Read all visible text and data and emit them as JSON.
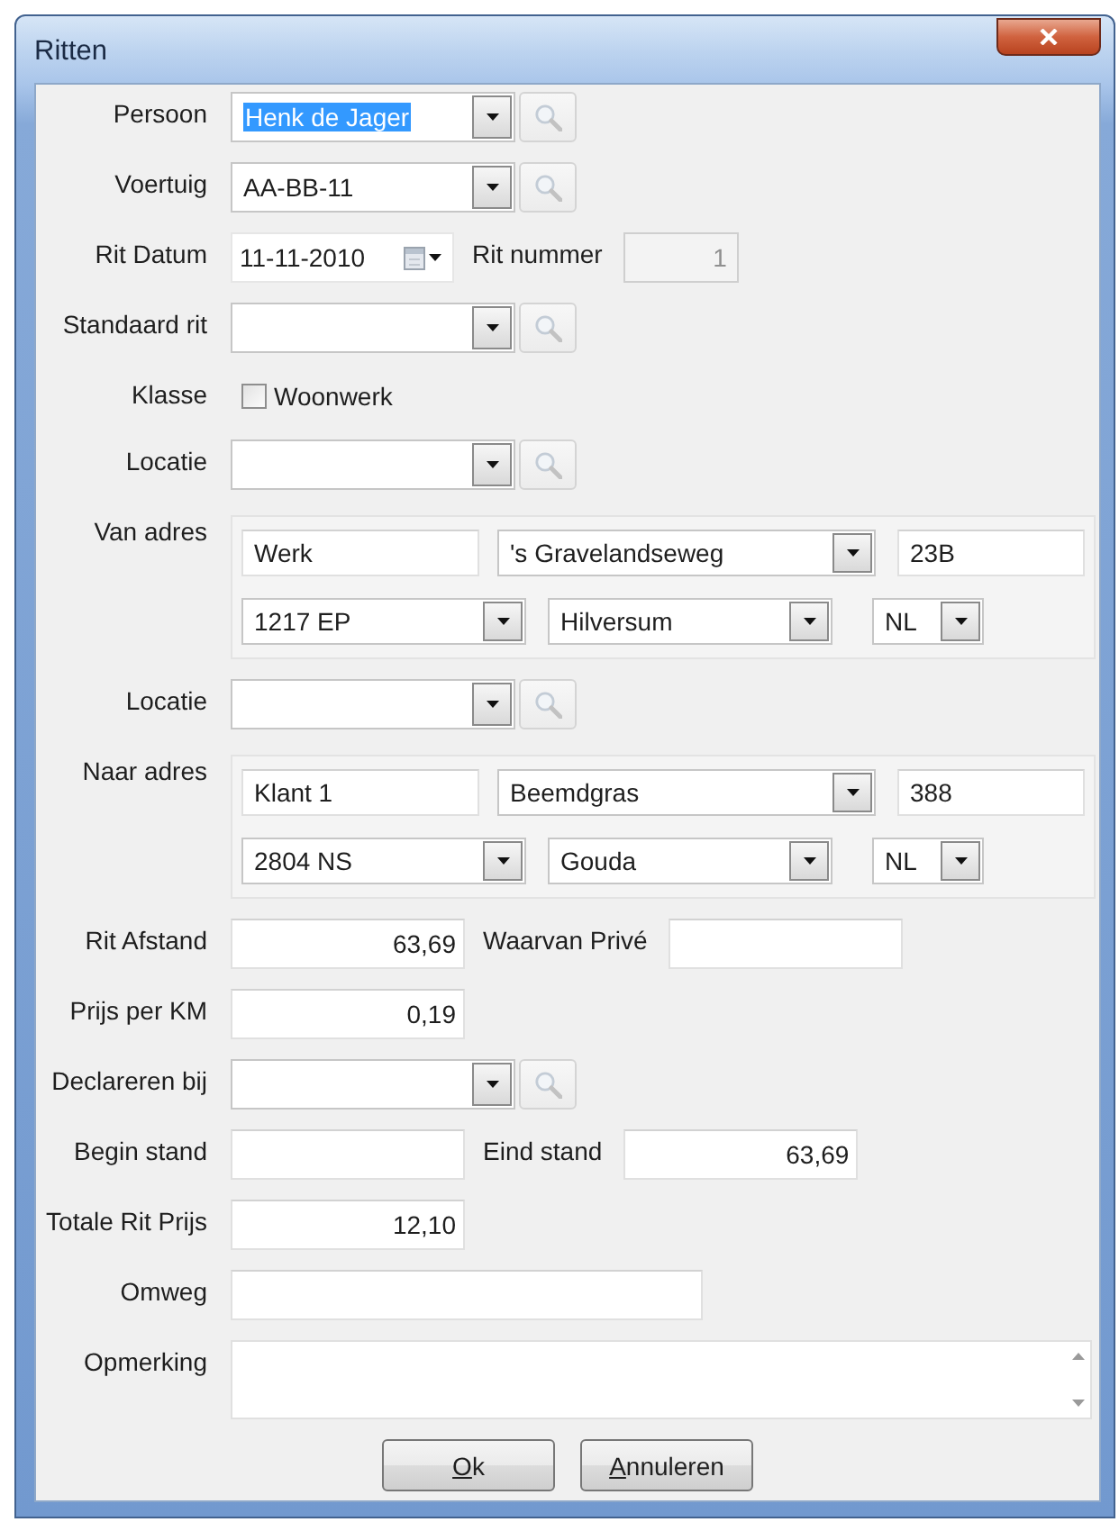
{
  "window": {
    "title": "Ritten"
  },
  "form": {
    "rows": [
      {
        "label": "Persoon",
        "controls": [
          {
            "kind": "lookup",
            "value": "Henk de Jager",
            "value_selected": true
          }
        ]
      },
      {
        "label": "Voertuig",
        "controls": [
          {
            "kind": "lookup",
            "value": "AA-BB-11",
            "value_selected": false
          }
        ]
      },
      {
        "label": "Rit Datum",
        "controls": [
          {
            "kind": "date",
            "value": "11-11-2010"
          },
          {
            "kind": "caption",
            "text": "Rit nummer"
          },
          {
            "kind": "counter",
            "value": "1",
            "disabled": true
          }
        ]
      },
      {
        "label": "Standaard rit",
        "controls": [
          {
            "kind": "lookup"
          }
        ]
      },
      {
        "label": "Klasse",
        "controls": [
          {
            "kind": "checkbox",
            "text": "Woonwerk",
            "checked": false
          }
        ]
      },
      {
        "label": "Locatie",
        "controls": [
          {
            "kind": "lookup"
          }
        ]
      },
      {
        "label": "Van adres",
        "controls": [
          {
            "kind": "address",
            "name": "Werk",
            "street": "'s Gravelandseweg",
            "number": "23B",
            "postcode": "1217 EP",
            "city": "Hilversum",
            "country": "NL"
          }
        ]
      },
      {
        "label": "Locatie",
        "controls": [
          {
            "kind": "lookup"
          }
        ]
      },
      {
        "label": "Naar adres",
        "controls": [
          {
            "kind": "address",
            "name": "Klant 1",
            "street": "Beemdgras",
            "number": "388",
            "postcode": "2804 NS",
            "city": "Gouda",
            "country": "NL"
          }
        ]
      },
      {
        "label": "Rit Afstand",
        "controls": [
          {
            "kind": "number",
            "value": "63,69"
          },
          {
            "kind": "caption",
            "text": "Waarvan Privé"
          },
          {
            "kind": "number"
          }
        ]
      },
      {
        "label": "Prijs per KM",
        "controls": [
          {
            "kind": "number",
            "value": "0,19"
          }
        ]
      },
      {
        "label": "Declareren bij",
        "controls": [
          {
            "kind": "lookup"
          }
        ]
      },
      {
        "label": "Begin stand",
        "controls": [
          {
            "kind": "number"
          },
          {
            "kind": "caption",
            "text": "Eind stand"
          },
          {
            "kind": "number",
            "value": "63,69"
          }
        ]
      },
      {
        "label": "Totale Rit Prijs",
        "controls": [
          {
            "kind": "number",
            "value": "12,10"
          }
        ]
      },
      {
        "label": "Omweg",
        "controls": [
          {
            "kind": "text"
          }
        ]
      },
      {
        "label": "Opmerking",
        "controls": [
          {
            "kind": "memo"
          }
        ]
      }
    ]
  },
  "buttons": [
    {
      "label": "Ok",
      "access_key": true
    },
    {
      "label": "Annuleren",
      "access_key": true
    }
  ]
}
